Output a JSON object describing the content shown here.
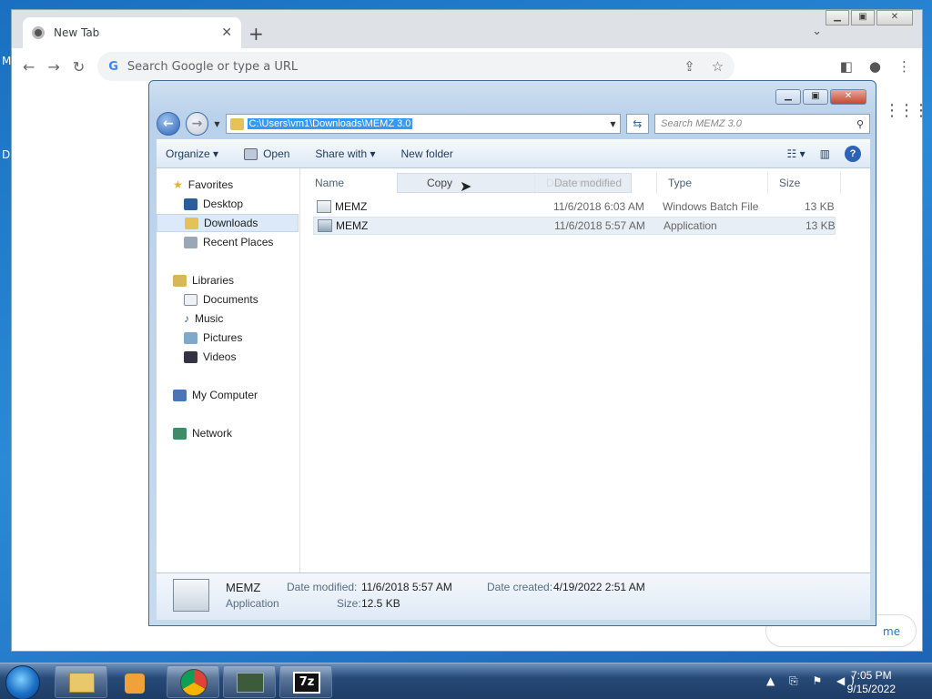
{
  "desktop": {
    "left_text_1": "M",
    "left_text_2": "D"
  },
  "chrome": {
    "tab_title": "New Tab",
    "tab_close": "✕",
    "new_tab": "+",
    "tab_search": "⌄",
    "omnibox_placeholder": "Search Google or type a URL",
    "customize_label": "me"
  },
  "explorer": {
    "address": "C:\\Users\\vm1\\Downloads\\MEMZ 3.0",
    "search_placeholder": "Search MEMZ 3.0",
    "commands": {
      "organize": "Organize ▾",
      "open": "Open",
      "share_with": "Share with ▾",
      "new_folder": "New folder"
    },
    "nav": {
      "favorites": "Favorites",
      "desktop": "Desktop",
      "downloads": "Downloads",
      "recent_places": "Recent Places",
      "libraries": "Libraries",
      "documents": "Documents",
      "music": "Music",
      "pictures": "Pictures",
      "videos": "Videos",
      "my_computer": "My Computer",
      "network": "Network"
    },
    "columns": {
      "name": "Name",
      "date_modified": "Date modified",
      "type": "Type",
      "size": "Size"
    },
    "files": [
      {
        "name": "MEMZ",
        "date": "11/6/2018 6:03 AM",
        "type": "Windows Batch File",
        "size": "13 KB"
      },
      {
        "name": "MEMZ",
        "date": "11/6/2018 5:57 AM",
        "type": "Application",
        "size": "13 KB"
      }
    ],
    "drag_tooltip": "Copy",
    "details": {
      "name": "MEMZ",
      "kind": "Application",
      "date_modified_label": "Date modified:",
      "date_modified": "11/6/2018 5:57 AM",
      "date_created_label": "Date created:",
      "date_created": "4/19/2022 2:51 AM",
      "size_label": "Size:",
      "size": "12.5 KB"
    }
  },
  "taskbar": {
    "time": "7:05 PM",
    "date": "9/15/2022",
    "sevenzip_label": "7z"
  }
}
